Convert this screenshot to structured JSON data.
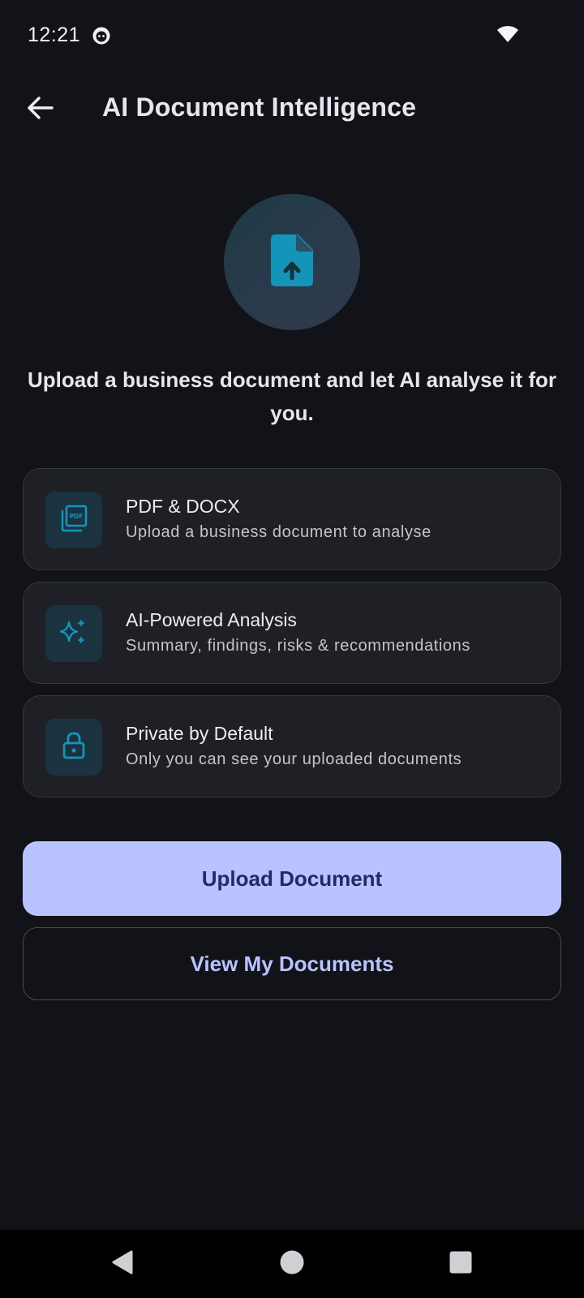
{
  "status_bar": {
    "time": "12:21"
  },
  "app_bar": {
    "title": "AI Document Intelligence",
    "back_icon": "arrow-back-icon"
  },
  "hero": {
    "icon": "file-upload-icon",
    "headline": "Upload a business document and let AI analyse it for you."
  },
  "features": [
    {
      "icon": "pdf-file-icon",
      "title": "PDF & DOCX",
      "subtitle": "Upload a business document to analyse"
    },
    {
      "icon": "sparkle-icon",
      "title": "AI-Powered Analysis",
      "subtitle": "Summary, findings, risks & recommendations"
    },
    {
      "icon": "lock-icon",
      "title": "Private by Default",
      "subtitle": "Only you can see your uploaded documents"
    }
  ],
  "actions": {
    "upload_label": "Upload Document",
    "view_label": "View My Documents"
  },
  "colors": {
    "background": "#121318",
    "card": "#1f2026",
    "accent": "#b9c3ff",
    "icon_teal": "#1494b8",
    "on_accent": "#222c60"
  },
  "nav_bar": {
    "back": "nav-back-icon",
    "home": "nav-home-icon",
    "recents": "nav-recents-icon"
  }
}
